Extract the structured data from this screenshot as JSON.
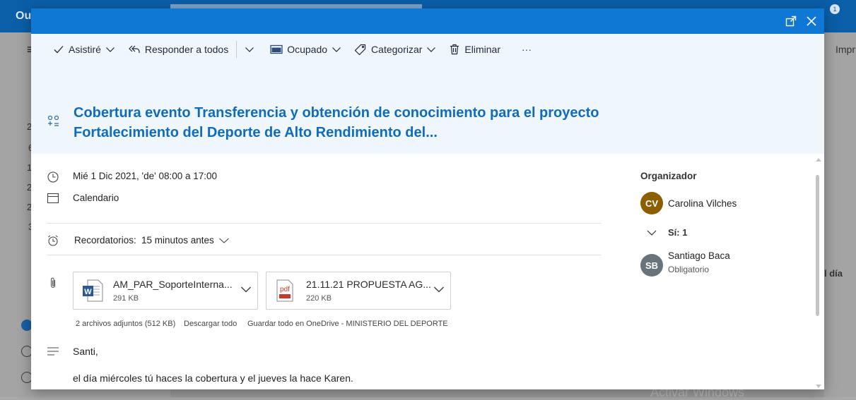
{
  "background": {
    "app_title": "Ou",
    "side_texts": [
      "2",
      "6",
      "1",
      "2",
      "2",
      "3"
    ],
    "right_text": "Impr",
    "right_snippet": "l día",
    "watermark": "Activar Windows",
    "badge": "1"
  },
  "toolbar": {
    "attended_label": "Asistiré",
    "reply_all_label": "Responder a todos",
    "busy_label": "Ocupado",
    "categorize_label": "Categorizar",
    "delete_label": "Eliminar",
    "more_label": "···"
  },
  "event": {
    "subject": "Cobertura evento Transferencia y obtención de conocimiento para el proyecto Fortalecimiento del Deporte de Alto Rendimiento del...",
    "datetime": "Mié 1 Dic 2021, 'de' 08:00 a 17:00",
    "calendar": "Calendario",
    "reminder_label": "Recordatorios:",
    "reminder_value": "15 minutos antes"
  },
  "attachments": {
    "items": [
      {
        "name": "AM_PAR_SoporteInterna...",
        "size": "291 KB",
        "icon": "word-icon"
      },
      {
        "name": "21.11.21 PROPUESTA AG...",
        "size": "220 KB",
        "icon": "pdf-icon"
      }
    ],
    "summary": "2 archivos adjuntos (512 KB)",
    "download_all": "Descargar todo",
    "save_onedrive": "Guardar todo en OneDrive - MINISTERIO DEL DEPORTE"
  },
  "body": {
    "greeting": "Santi,",
    "line1": "el día miércoles tú haces la cobertura y el jueves la hace Karen."
  },
  "people": {
    "organizer_heading": "Organizador",
    "organizer": {
      "initials": "CV",
      "name": "Carolina Vilches",
      "color": "#8c5e00"
    },
    "yes_label": "Sí: 1",
    "attendee": {
      "initials": "SB",
      "name": "Santiago Baca",
      "role": "Obligatorio",
      "color": "#69737c"
    }
  },
  "colors": {
    "accent": "#0f78d4",
    "subject": "#0f6cbd",
    "header_bg": "#eff6fc"
  }
}
